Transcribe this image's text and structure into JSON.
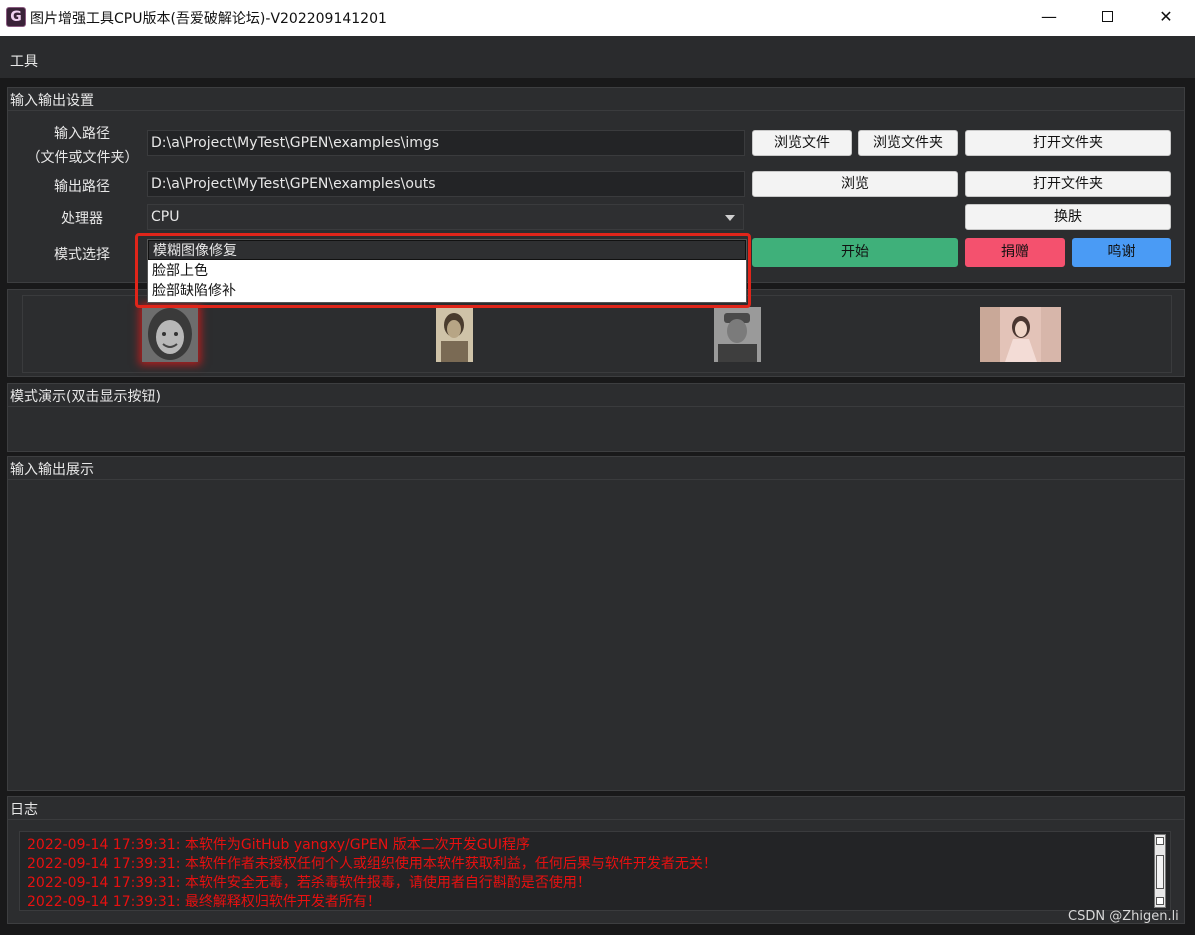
{
  "window": {
    "app_icon_letter": "G",
    "title": "图片增强工具CPU版本(吾爱破解论坛)-V202209141201",
    "minimize": "—",
    "close": "✕"
  },
  "menu": {
    "tools": "工具"
  },
  "io_settings": {
    "title": "输入输出设置",
    "input_label_1": "输入路径",
    "input_label_2": "（文件或文件夹）",
    "input_path": "D:\\a\\Project\\MyTest\\GPEN\\examples\\imgs",
    "browse_file": "浏览文件",
    "browse_folder": "浏览文件夹",
    "open_folder_1": "打开文件夹",
    "output_label": "输出路径",
    "output_path": "D:\\a\\Project\\MyTest\\GPEN\\examples\\outs",
    "browse": "浏览",
    "open_folder_2": "打开文件夹",
    "processor_label": "处理器",
    "processor_value": "CPU",
    "skin_button": "换肤",
    "mode_label": "模式选择",
    "mode_options": [
      "模糊图像修复",
      "脸部上色",
      "脸部缺陷修补"
    ],
    "start_button": "开始",
    "donate_button": "捐赠",
    "thanks_button": "鸣谢"
  },
  "demo": {
    "title": "模式演示(双击显示按钮)"
  },
  "display": {
    "title": "输入输出展示"
  },
  "log": {
    "title": "日志",
    "color": "#e81010",
    "lines": [
      "2022-09-14 17:39:31: 本软件为GitHub yangxy/GPEN 版本二次开发GUI程序",
      "2022-09-14 17:39:31: 本软件作者未授权任何个人或组织使用本软件获取利益，任何后果与软件开发者无关！",
      "2022-09-14 17:39:31: 本软件安全无毒，若杀毒软件报毒，请使用者自行斟酌是否使用！",
      "2022-09-14 17:39:31: 最终解释权归软件开发者所有！"
    ]
  },
  "watermark": "CSDN @Zhigen.li"
}
